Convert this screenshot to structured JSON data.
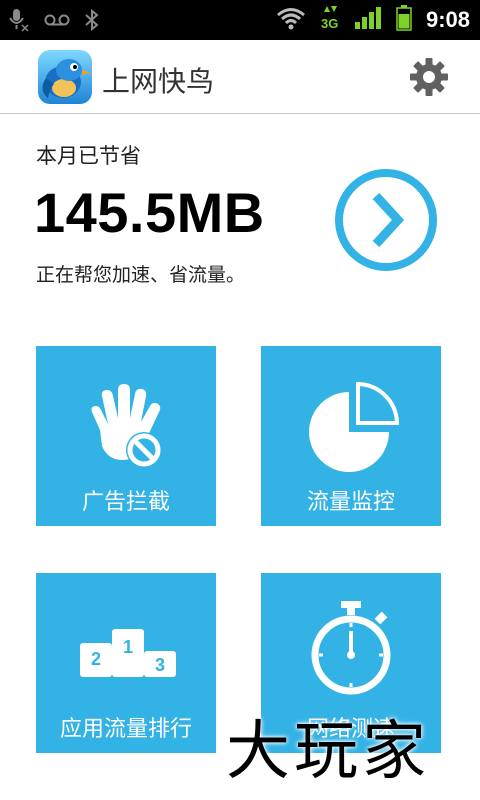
{
  "status_bar": {
    "time": "9:08",
    "network": "3G"
  },
  "app": {
    "title": "上网快鸟"
  },
  "savings": {
    "label": "本月已节省",
    "value": "145.5MB",
    "subtitle": "正在帮您加速、省流量。"
  },
  "tiles": [
    {
      "label": "广告拦截",
      "icon": "hand-block-icon"
    },
    {
      "label": "流量监控",
      "icon": "pie-chart-icon"
    },
    {
      "label": "应用流量排行",
      "icon": "podium-icon"
    },
    {
      "label": "网络测速",
      "icon": "stopwatch-icon"
    }
  ],
  "watermark": "大玩家",
  "colors": {
    "accent": "#33b2e6",
    "header_border": "#c9c9c9"
  }
}
